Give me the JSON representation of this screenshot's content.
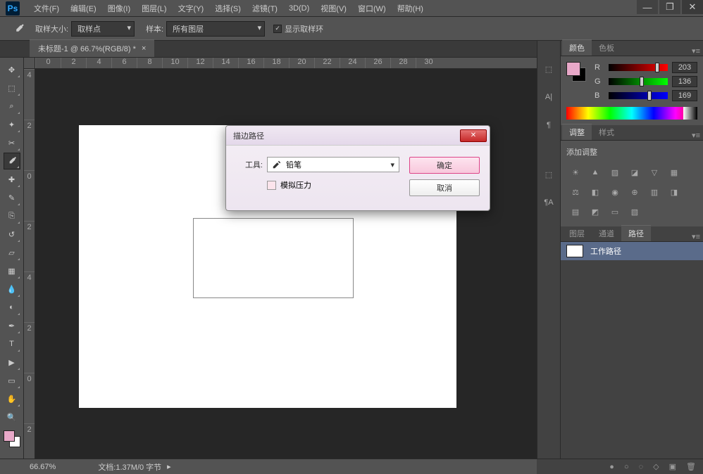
{
  "app": {
    "logo": "Ps"
  },
  "menu": [
    "文件(F)",
    "编辑(E)",
    "图像(I)",
    "图层(L)",
    "文字(Y)",
    "选择(S)",
    "滤镜(T)",
    "3D(D)",
    "视图(V)",
    "窗口(W)",
    "帮助(H)"
  ],
  "options": {
    "sample_size_label": "取样大小:",
    "sample_size_value": "取样点",
    "sample_label": "样本:",
    "sample_value": "所有图层",
    "show_ring": "显示取样环"
  },
  "doc_tab": {
    "title": "未标题-1 @ 66.7%(RGB/8) *",
    "close": "×"
  },
  "ruler_h": [
    "0",
    "2",
    "4",
    "6",
    "8",
    "10",
    "12",
    "14",
    "16",
    "18",
    "20",
    "22",
    "24",
    "26",
    "28",
    "30"
  ],
  "ruler_v": [
    "4",
    "2",
    "0",
    "2",
    "4",
    "2",
    "0",
    "2"
  ],
  "tools": [
    "move",
    "marquee",
    "lasso",
    "wand",
    "crop",
    "eyedropper",
    "heal",
    "brush",
    "stamp",
    "history",
    "eraser",
    "gradient",
    "blur",
    "dodge",
    "pen",
    "type",
    "path-select",
    "rectangle",
    "hand",
    "zoom"
  ],
  "panels": {
    "color": {
      "tabs": [
        "颜色",
        "色板"
      ],
      "r": "203",
      "g": "136",
      "b": "169"
    },
    "adjust": {
      "tabs": [
        "调整",
        "样式"
      ],
      "title": "添加调整"
    },
    "paths": {
      "tabs": [
        "图层",
        "通道",
        "路径"
      ],
      "item": "工作路径"
    }
  },
  "status": {
    "zoom": "66.67%",
    "info": "文档:1.37M/0 字节"
  },
  "dialog": {
    "title": "描边路径",
    "tool_label": "工具:",
    "tool_value": "铅笔",
    "pressure": "模拟压力",
    "ok": "确定",
    "cancel": "取消"
  }
}
